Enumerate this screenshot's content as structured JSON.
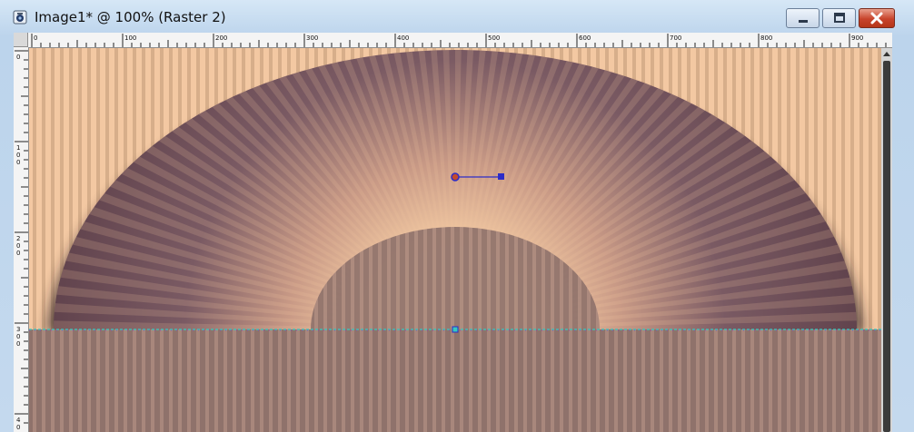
{
  "window": {
    "title": "Image1* @ 100% (Raster 2)",
    "controls": [
      "minimize",
      "maximize",
      "close"
    ]
  },
  "rulers": {
    "horizontal_labels": [
      "0",
      "100",
      "200",
      "300",
      "400",
      "500",
      "600",
      "700",
      "800",
      "900"
    ],
    "vertical_labels": [
      "0",
      "100",
      "200",
      "300",
      "400"
    ]
  },
  "canvas": {
    "background_color": "#f3c8a2",
    "fan_color": "#5e4049",
    "lower_color": "#8a6e68",
    "zoom": "100%",
    "layer": "Raster 2"
  },
  "icons": {
    "app": "paint-app-icon",
    "minimize": "minimize-icon",
    "maximize": "maximize-icon",
    "close": "close-icon"
  }
}
